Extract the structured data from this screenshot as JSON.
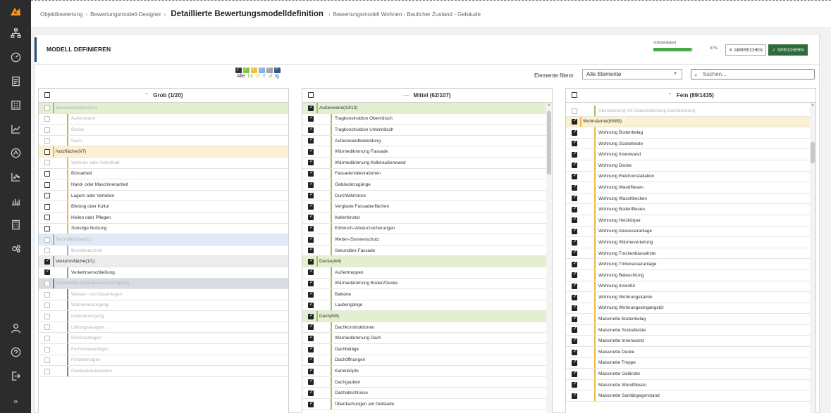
{
  "breadcrumb": {
    "item1": "Objektbewertung",
    "item2": "Bewertungsmodell-Designer",
    "current": "Detaillierte Bewertungsmodelldefinition",
    "item4": "Bewertungsmodell Wohnen - Baulicher Zustand - Gebäude"
  },
  "header": {
    "title": "MODELL DEFINIEREN",
    "progress_label": "Vollständigkeit",
    "progress_value": 0.97,
    "progress_text": "97%",
    "cancel_label": "ABBRECHEN",
    "save_label": "SPEICHERN"
  },
  "legend": {
    "labels": [
      "Alle",
      "bk",
      "nf",
      "tf",
      "vf",
      "tg"
    ],
    "colors": [
      "#333333",
      "#8fbf4a",
      "#f0c040",
      "#7fb0e0",
      "#a0a0a0",
      "#2c5a8a"
    ]
  },
  "filter": {
    "label": "Elemente filtern",
    "selected": "Alle Elemente",
    "search_placeholder": "Suchen..."
  },
  "columns": {
    "grob": {
      "title": "Grob (1/20)",
      "rows": [
        {
          "label": "Baukonstruktion(0/3)",
          "level": 0,
          "checked": false,
          "disabled": true,
          "group": "bk"
        },
        {
          "label": "Außenwand",
          "level": 1,
          "checked": false,
          "disabled": true,
          "group": "bk"
        },
        {
          "label": "Decke",
          "level": 1,
          "checked": false,
          "disabled": true,
          "group": "bk"
        },
        {
          "label": "Dach",
          "level": 1,
          "checked": false,
          "disabled": true,
          "group": "bk"
        },
        {
          "label": "Nutzfläche(0/7)",
          "level": 0,
          "checked": false,
          "disabled": false,
          "group": "nf"
        },
        {
          "label": "Wohnen oder Aufenthalt",
          "level": 1,
          "checked": false,
          "disabled": true,
          "group": "nf"
        },
        {
          "label": "Büroarbeit",
          "level": 1,
          "checked": false,
          "disabled": false,
          "group": "nf"
        },
        {
          "label": "Hand- oder Maschinenarbeit",
          "level": 1,
          "checked": false,
          "disabled": false,
          "group": "nf"
        },
        {
          "label": "Lagern oder Verteilen",
          "level": 1,
          "checked": false,
          "disabled": false,
          "group": "nf"
        },
        {
          "label": "Bildung oder Kultur",
          "level": 1,
          "checked": false,
          "disabled": false,
          "group": "nf"
        },
        {
          "label": "Heilen oder Pflegen",
          "level": 1,
          "checked": false,
          "disabled": false,
          "group": "nf"
        },
        {
          "label": "Sonstige Nutzung",
          "level": 1,
          "checked": false,
          "disabled": false,
          "group": "nf"
        },
        {
          "label": "Technikfläche(0/1)",
          "level": 0,
          "checked": false,
          "disabled": true,
          "group": "tf"
        },
        {
          "label": "Betriebstechnik",
          "level": 1,
          "checked": false,
          "disabled": true,
          "group": "tf"
        },
        {
          "label": "Verkehrsfläche(1/1)",
          "level": 0,
          "checked": true,
          "disabled": false,
          "group": "vf"
        },
        {
          "label": "Verkehrserschließung",
          "level": 1,
          "checked": true,
          "disabled": false,
          "group": "vf"
        },
        {
          "label": "Technische Gebäudeausrüstung(0/8)",
          "level": 0,
          "checked": false,
          "disabled": true,
          "group": "tg"
        },
        {
          "label": "Wasser- und Gasanlagen",
          "level": 1,
          "checked": false,
          "disabled": true,
          "group": "tg"
        },
        {
          "label": "Wärmeversorgung",
          "level": 1,
          "checked": false,
          "disabled": true,
          "group": "tg"
        },
        {
          "label": "Kälteversorgung",
          "level": 1,
          "checked": false,
          "disabled": true,
          "group": "tg"
        },
        {
          "label": "Lüftungsanlagen",
          "level": 1,
          "checked": false,
          "disabled": true,
          "group": "tg"
        },
        {
          "label": "Elektroanlagen",
          "level": 1,
          "checked": false,
          "disabled": true,
          "group": "tg"
        },
        {
          "label": "Fernmeldeanlagen",
          "level": 1,
          "checked": false,
          "disabled": true,
          "group": "tg"
        },
        {
          "label": "Förderanlagen",
          "level": 1,
          "checked": false,
          "disabled": true,
          "group": "tg"
        },
        {
          "label": "Gebäudeautomation",
          "level": 1,
          "checked": false,
          "disabled": true,
          "group": "tg"
        }
      ]
    },
    "mittel": {
      "title": "Mittel (62/107)",
      "rows": [
        {
          "label": "Außenwand(13/13)",
          "level": 0,
          "checked": true,
          "disabled": false,
          "group": "bk"
        },
        {
          "label": "Tragkonstruktion Oberirdisch",
          "level": 1,
          "checked": true,
          "disabled": false,
          "group": "bk"
        },
        {
          "label": "Tragkonstruktion Unterirdisch",
          "level": 1,
          "checked": true,
          "disabled": false,
          "group": "bk"
        },
        {
          "label": "Außenwandbekleidung",
          "level": 1,
          "checked": true,
          "disabled": false,
          "group": "bk"
        },
        {
          "label": "Wärmedämmung Fassade",
          "level": 1,
          "checked": true,
          "disabled": false,
          "group": "bk"
        },
        {
          "label": "Wärmedämmung Kelleraußenwand",
          "level": 1,
          "checked": true,
          "disabled": false,
          "group": "bk"
        },
        {
          "label": "Fassadendekorationen",
          "level": 1,
          "checked": true,
          "disabled": false,
          "group": "bk"
        },
        {
          "label": "Gebäudezugänge",
          "level": 1,
          "checked": true,
          "disabled": false,
          "group": "bk"
        },
        {
          "label": "Durchfahrtstore",
          "level": 1,
          "checked": true,
          "disabled": false,
          "group": "bk"
        },
        {
          "label": "Verglaste Fassadenflächen",
          "level": 1,
          "checked": true,
          "disabled": false,
          "group": "bk"
        },
        {
          "label": "Kellerfenster",
          "level": 1,
          "checked": true,
          "disabled": false,
          "group": "bk"
        },
        {
          "label": "Einbruch-/Absturzsicherungen",
          "level": 1,
          "checked": true,
          "disabled": false,
          "group": "bk"
        },
        {
          "label": "Wetter-/Sonnenschutz",
          "level": 1,
          "checked": true,
          "disabled": false,
          "group": "bk"
        },
        {
          "label": "Sekundäre Fassade",
          "level": 1,
          "checked": true,
          "disabled": false,
          "group": "bk"
        },
        {
          "label": "Decke(4/4)",
          "level": 0,
          "checked": true,
          "disabled": false,
          "group": "bk"
        },
        {
          "label": "Außentreppen",
          "level": 1,
          "checked": true,
          "disabled": false,
          "group": "bk"
        },
        {
          "label": "Wärmedämmung Boden/Decke",
          "level": 1,
          "checked": true,
          "disabled": false,
          "group": "bk"
        },
        {
          "label": "Balkone",
          "level": 1,
          "checked": true,
          "disabled": false,
          "group": "bk"
        },
        {
          "label": "Laubengänge",
          "level": 1,
          "checked": true,
          "disabled": false,
          "group": "bk"
        },
        {
          "label": "Dach(8/8)",
          "level": 0,
          "checked": true,
          "disabled": false,
          "group": "bk"
        },
        {
          "label": "Dachkonstruktionen",
          "level": 1,
          "checked": true,
          "disabled": false,
          "group": "bk"
        },
        {
          "label": "Wärmedämmung Dach",
          "level": 1,
          "checked": true,
          "disabled": false,
          "group": "bk"
        },
        {
          "label": "Dachbeläge",
          "level": 1,
          "checked": true,
          "disabled": false,
          "group": "bk"
        },
        {
          "label": "Dachöffnungen",
          "level": 1,
          "checked": true,
          "disabled": false,
          "group": "bk"
        },
        {
          "label": "Kaminköpfe",
          "level": 1,
          "checked": true,
          "disabled": false,
          "group": "bk"
        },
        {
          "label": "Dachgauben",
          "level": 1,
          "checked": true,
          "disabled": false,
          "group": "bk"
        },
        {
          "label": "Dachabschlüsse",
          "level": 1,
          "checked": true,
          "disabled": false,
          "group": "bk"
        },
        {
          "label": "Überdachungen am Gebäude",
          "level": 1,
          "checked": true,
          "disabled": false,
          "group": "bk"
        }
      ]
    },
    "fein": {
      "title": "Fein (89/1435)",
      "rows": [
        {
          "label": "Überdachung mit Glaseindeckung Dachdeckung",
          "level": 1,
          "checked": false,
          "disabled": true,
          "group": "bk"
        },
        {
          "label": "Wohnräume(89/89)",
          "level": 0,
          "checked": true,
          "disabled": false,
          "group": "nf"
        },
        {
          "label": "Wohnung Bodenbelag",
          "level": 1,
          "checked": true,
          "disabled": false,
          "group": "nf"
        },
        {
          "label": "Wohnung Sockelleiste",
          "level": 1,
          "checked": true,
          "disabled": false,
          "group": "nf"
        },
        {
          "label": "Wohnung Innenwand",
          "level": 1,
          "checked": true,
          "disabled": false,
          "group": "nf"
        },
        {
          "label": "Wohnung Decke",
          "level": 1,
          "checked": true,
          "disabled": false,
          "group": "nf"
        },
        {
          "label": "Wohnung Elektroinstallation",
          "level": 1,
          "checked": true,
          "disabled": false,
          "group": "nf"
        },
        {
          "label": "Wohnung Wandfliesen",
          "level": 1,
          "checked": true,
          "disabled": false,
          "group": "nf"
        },
        {
          "label": "Wohnung Waschbecken",
          "level": 1,
          "checked": true,
          "disabled": false,
          "group": "nf"
        },
        {
          "label": "Wohnung Bodenfliesen",
          "level": 1,
          "checked": true,
          "disabled": false,
          "group": "nf"
        },
        {
          "label": "Wohnung Heizkörper",
          "level": 1,
          "checked": true,
          "disabled": false,
          "group": "nf"
        },
        {
          "label": "Wohnung Abwasseranlage",
          "level": 1,
          "checked": true,
          "disabled": false,
          "group": "nf"
        },
        {
          "label": "Wohnung Wärmeverteilung",
          "level": 1,
          "checked": true,
          "disabled": false,
          "group": "nf"
        },
        {
          "label": "Wohnung Trockenbauwände",
          "level": 1,
          "checked": true,
          "disabled": false,
          "group": "nf"
        },
        {
          "label": "Wohnung Trinkwasseranlage",
          "level": 1,
          "checked": true,
          "disabled": false,
          "group": "nf"
        },
        {
          "label": "Wohnung Beleuchtung",
          "level": 1,
          "checked": true,
          "disabled": false,
          "group": "nf"
        },
        {
          "label": "Wohnung Innentür",
          "level": 1,
          "checked": true,
          "disabled": false,
          "group": "nf"
        },
        {
          "label": "Wohnung Wohnungskamin",
          "level": 1,
          "checked": true,
          "disabled": false,
          "group": "nf"
        },
        {
          "label": "Wohnung Wohnungseingangstür",
          "level": 1,
          "checked": true,
          "disabled": false,
          "group": "nf"
        },
        {
          "label": "Maisonette Bodenbelag",
          "level": 1,
          "checked": true,
          "disabled": false,
          "group": "nf"
        },
        {
          "label": "Maisonette Sockelleiste",
          "level": 1,
          "checked": true,
          "disabled": false,
          "group": "nf"
        },
        {
          "label": "Maisonette Innenwand",
          "level": 1,
          "checked": true,
          "disabled": false,
          "group": "nf"
        },
        {
          "label": "Maisonette Decke",
          "level": 1,
          "checked": true,
          "disabled": false,
          "group": "nf"
        },
        {
          "label": "Maisonette Treppe",
          "level": 1,
          "checked": true,
          "disabled": false,
          "group": "nf"
        },
        {
          "label": "Maisonette Geländer",
          "level": 1,
          "checked": true,
          "disabled": false,
          "group": "nf"
        },
        {
          "label": "Maisonette Wandfliesen",
          "level": 1,
          "checked": true,
          "disabled": false,
          "group": "nf"
        },
        {
          "label": "Maisonette Sanitärgegenstand",
          "level": 1,
          "checked": true,
          "disabled": false,
          "group": "nf"
        }
      ]
    }
  },
  "colors": {
    "group_bk": "#e3efcf",
    "group_nf": "#fbf0cf",
    "group_tf": "#dfeaf7",
    "group_vf": "#ececec",
    "group_tg": "#d9dde3",
    "bar_bk": "#9cc35a",
    "bar_nf": "#f0b640",
    "bar_tf": "#8ab6e0",
    "bar_vf": "#999999",
    "bar_tg": "#6f87a3"
  }
}
